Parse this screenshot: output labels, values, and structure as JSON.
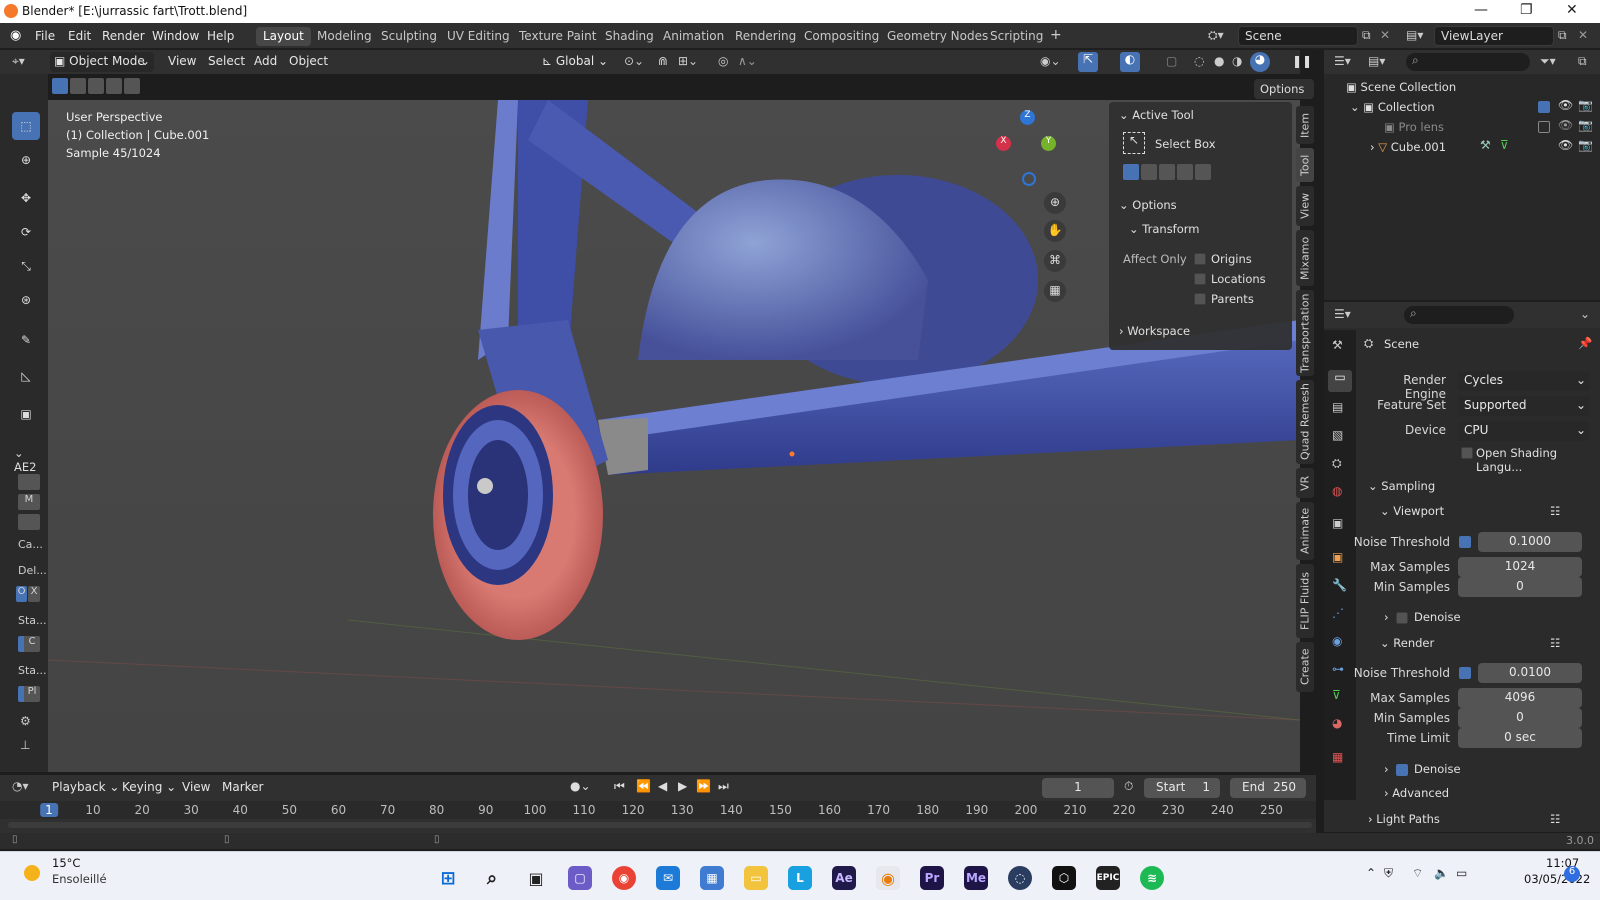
{
  "window": {
    "title": "Blender* [E:\\jurrassic fart\\Trott.blend]"
  },
  "menu": [
    "File",
    "Edit",
    "Render",
    "Window",
    "Help"
  ],
  "workspaces": [
    "Layout",
    "Modeling",
    "Sculpting",
    "UV Editing",
    "Texture Paint",
    "Shading",
    "Animation",
    "Rendering",
    "Compositing",
    "Geometry Nodes",
    "Scripting"
  ],
  "active_workspace": "Layout",
  "scene_field": "Scene",
  "viewlayer_field": "ViewLayer",
  "header3d": {
    "mode": "Object Mode",
    "menus": [
      "View",
      "Select",
      "Add",
      "Object"
    ],
    "orientation": "Global",
    "options": "Options"
  },
  "overlay": {
    "line1": "User Perspective",
    "line2": "(1) Collection | Cube.001",
    "line3": "Sample 45/1024"
  },
  "gizmo": {
    "x": "X",
    "y": "Y",
    "z": "Z"
  },
  "active_tool_panel": {
    "header": "Active Tool",
    "tool": "Select Box",
    "options_header": "Options",
    "transform_header": "Transform",
    "affect_only": "Affect Only",
    "checks": [
      "Origins",
      "Locations",
      "Parents"
    ],
    "workspace": "Workspace"
  },
  "side_tabs": [
    "Item",
    "Tool",
    "View",
    "Mixamo",
    "Transportation",
    "Quad Remesh",
    "VR",
    "Animate",
    "FLIP Fluids",
    "Create"
  ],
  "addon_panel": {
    "header": "AE2",
    "items": [
      "M",
      "Ca...",
      "Del...",
      "O",
      "X",
      "Sta...",
      "C",
      "Sta...",
      "Pl"
    ]
  },
  "outliner": {
    "scene_collection": "Scene Collection",
    "collection": "Collection",
    "pro_lens": "Pro lens",
    "cube": "Cube.001"
  },
  "properties": {
    "scene_label": "Scene",
    "render_engine_label": "Render Engine",
    "render_engine": "Cycles",
    "feature_set_label": "Feature Set",
    "feature_set": "Supported",
    "device_label": "Device",
    "device": "CPU",
    "osl_label": "Open Shading Langu...",
    "sampling": "Sampling",
    "viewport": "Viewport",
    "vp_noise_label": "Noise Threshold",
    "vp_noise": "0.1000",
    "vp_max_label": "Max Samples",
    "vp_max": "1024",
    "vp_min_label": "Min Samples",
    "vp_min": "0",
    "vp_denoise": "Denoise",
    "render": "Render",
    "r_noise_label": "Noise Threshold",
    "r_noise": "0.0100",
    "r_max_label": "Max Samples",
    "r_max": "4096",
    "r_min_label": "Min Samples",
    "r_min": "0",
    "time_limit_label": "Time Limit",
    "time_limit": "0 sec",
    "r_denoise": "Denoise",
    "advanced": "Advanced",
    "light_paths": "Light Paths"
  },
  "timeline": {
    "menus": [
      "Playback",
      "Keying",
      "View",
      "Marker"
    ],
    "current_frame": "1",
    "start_label": "Start",
    "start": "1",
    "end_label": "End",
    "end": "250",
    "ticks": [
      "1",
      "10",
      "20",
      "30",
      "40",
      "50",
      "60",
      "70",
      "80",
      "90",
      "100",
      "110",
      "120",
      "130",
      "140",
      "150",
      "160",
      "170",
      "180",
      "190",
      "200",
      "210",
      "220",
      "230",
      "240",
      "250"
    ]
  },
  "status": {
    "version": "3.0.0"
  },
  "taskbar": {
    "weather_temp": "15°C",
    "weather_text": "Ensoleillé",
    "time": "11:07",
    "date": "03/05/2022",
    "notif": "6"
  }
}
